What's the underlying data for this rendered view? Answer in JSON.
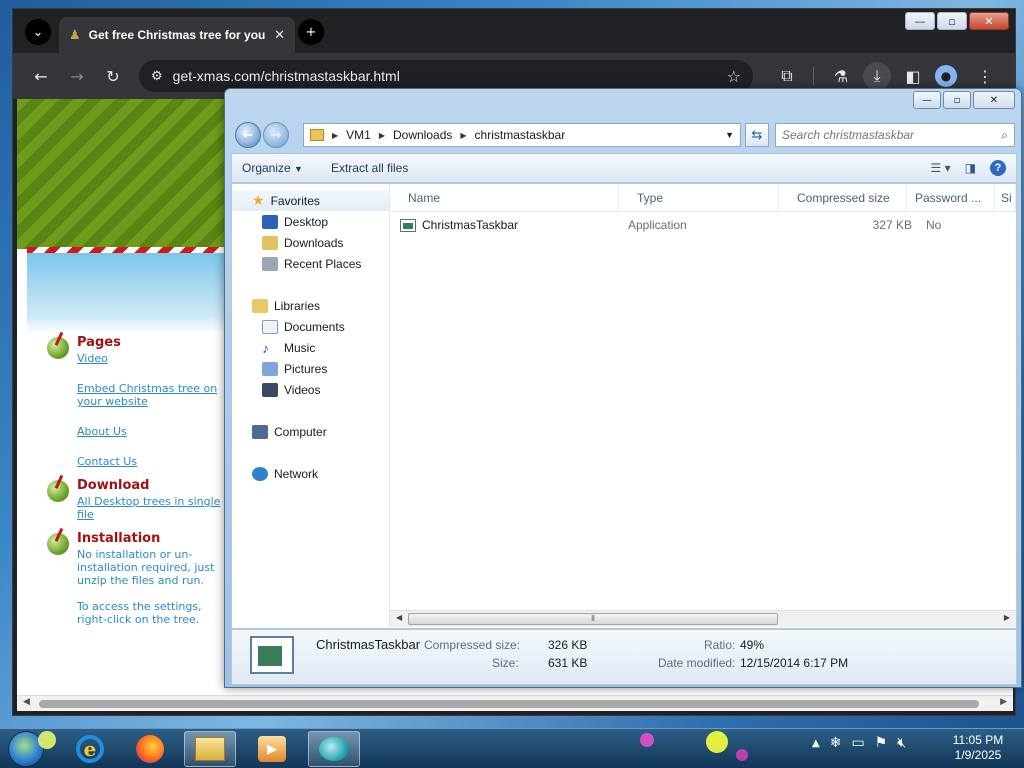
{
  "browser": {
    "tab_title": "Get free Christmas tree for your",
    "url": "get-xmas.com/christmastaskbar.html"
  },
  "website": {
    "sections": [
      {
        "heading": "Pages",
        "links": [
          "Video",
          "Embed Christmas tree on your website",
          "About Us",
          "Contact Us"
        ]
      },
      {
        "heading": "Download",
        "links": [
          "All Desktop trees in single file"
        ]
      },
      {
        "heading": "Installation",
        "paragraphs": [
          "No installation or un-installation required, just unzip the files and run.",
          "To access the settings, right-click on the tree."
        ]
      }
    ]
  },
  "explorer": {
    "breadcrumb": [
      "VM1",
      "Downloads",
      "christmastaskbar"
    ],
    "search_placeholder": "Search christmastaskbar",
    "toolbar": {
      "organize": "Organize",
      "extract_all": "Extract all files"
    },
    "nav_pane": {
      "favorites": {
        "label": "Favorites",
        "items": [
          "Desktop",
          "Downloads",
          "Recent Places"
        ]
      },
      "libraries": {
        "label": "Libraries",
        "items": [
          "Documents",
          "Music",
          "Pictures",
          "Videos"
        ]
      },
      "computer": "Computer",
      "network": "Network"
    },
    "columns": [
      "Name",
      "Type",
      "Compressed size",
      "Password ...",
      "Si"
    ],
    "files": [
      {
        "name": "ChristmasTaskbar",
        "type": "Application",
        "compressed_size": "327 KB",
        "password": "No"
      }
    ],
    "details": {
      "name": "ChristmasTaskbar",
      "compressed_size_label": "Compressed size:",
      "compressed_size": "326 KB",
      "size_label": "Size:",
      "size": "631 KB",
      "ratio_label": "Ratio:",
      "ratio": "49%",
      "date_modified_label": "Date modified:",
      "date_modified": "12/15/2014 6:17 PM"
    }
  },
  "taskbar": {
    "time": "11:05 PM",
    "date": "1/9/2025"
  }
}
